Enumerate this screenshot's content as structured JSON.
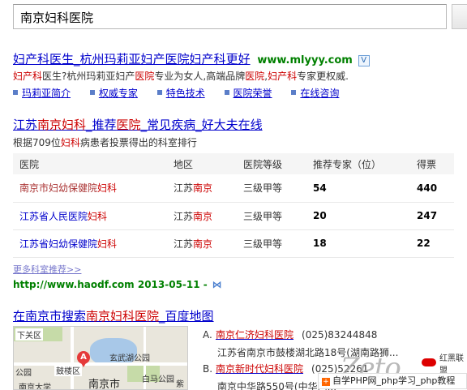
{
  "search": {
    "query": "南京妇科医院"
  },
  "result1": {
    "title_parts": [
      "妇产科",
      "医生_杭州玛莉亚妇产",
      "医院",
      "妇产科",
      "更好"
    ],
    "url": "www.mlyyy.com",
    "badge": "V",
    "desc_parts": [
      "妇产科",
      "医生?杭州玛莉亚妇产",
      "医院",
      "专业为女人,高端品牌",
      "医院",
      ",",
      "妇产科",
      "专家更权威."
    ],
    "links": [
      "玛莉亚简介",
      "权威专家",
      "特色技术",
      "医院荣誉",
      "在线咨询"
    ]
  },
  "result2": {
    "title_parts": [
      "江苏",
      "南京妇科",
      "_推荐",
      "医院",
      "_常见疾病_好大夫在线"
    ],
    "sub_parts": [
      "根据709位",
      "妇科",
      "病患者投票得出的科室排行"
    ],
    "headers": [
      "医院",
      "地区",
      "医院等级",
      "推荐专家（位）",
      "得票"
    ],
    "rows": [
      {
        "hosp_parts": [
          "南京市妇幼保健院",
          "妇科"
        ],
        "region_parts": [
          "江苏",
          "南京"
        ],
        "level": "三级甲等",
        "experts": "54",
        "votes": "440"
      },
      {
        "hosp_parts": [
          "江苏省人民医院",
          "妇科"
        ],
        "region_parts": [
          "江苏",
          "南京"
        ],
        "level": "三级甲等",
        "experts": "20",
        "votes": "247"
      },
      {
        "hosp_parts": [
          "江苏省妇幼保健院",
          "妇科"
        ],
        "region_parts": [
          "江苏",
          "南京"
        ],
        "level": "三级甲等",
        "experts": "18",
        "votes": "22"
      }
    ],
    "more": "更多科室推荐>>",
    "url": "http://www.haodf.com 2013-05-11 -"
  },
  "result3": {
    "title_parts": [
      "在南京市搜索",
      "南京妇科医院",
      "_百度地图"
    ],
    "map_labels": [
      "下关区",
      "玄武湖公园",
      "公园",
      "鼓楼区",
      "白马公园",
      "南京市",
      "南京大学",
      "紫"
    ],
    "pin": "A",
    "locations": [
      {
        "letter": "A.",
        "name_parts": [
          "南京仁济",
          "妇科医院"
        ],
        "phone": "(025)83244848",
        "addr": "江苏省南京市鼓楼湖北路18号(湖南路狮..."
      },
      {
        "letter": "B.",
        "name_parts": [
          "南京新时代",
          "妇科医院"
        ],
        "phone": "(025)52261",
        "addr": "南京中华路550号(中华门..."
      }
    ]
  },
  "watermark": {
    "logo": "Zeto",
    "tag": "红黑联盟",
    "bar": "自学PHP网_php学习_php教程"
  },
  "colors": {
    "link": "#0000cc",
    "highlight": "#cc0000",
    "url": "#008000"
  }
}
